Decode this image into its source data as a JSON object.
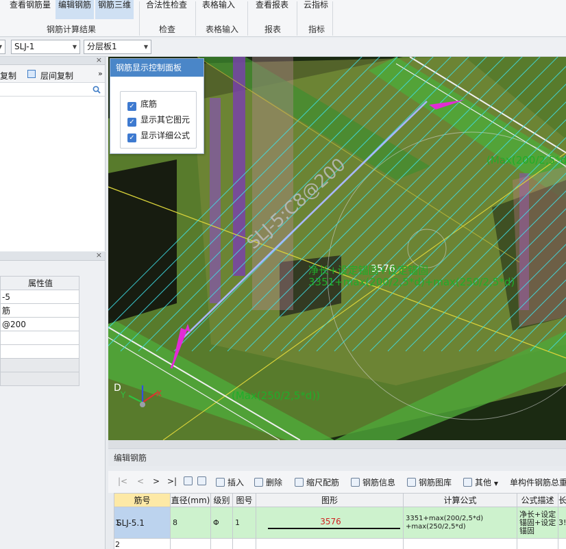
{
  "ribbon": {
    "buttons": {
      "view_rebar_qty": "查看钢筋量",
      "edit_rebar": "编辑钢筋",
      "rebar_3d": "钢筋三维",
      "legality_check": "合法性检查",
      "table_input": "表格输入",
      "view_report": "查看报表",
      "cloud_index": "云指标"
    },
    "groups": {
      "rebar_result": "钢筋计算结果",
      "check": "检查",
      "table_input": "表格输入",
      "report": "报表",
      "index": "指标"
    }
  },
  "selectors": {
    "element": "SLJ-1",
    "layer": "分层板1"
  },
  "left_panel": {
    "copy_label": "复制",
    "floor_copy_label": "层间复制",
    "more_icon": "»",
    "props_header": "属性值",
    "props_values": [
      "-5",
      "筋",
      "@200",
      "",
      "",
      "",
      ""
    ]
  },
  "control_panel": {
    "title": "钢筋显示控制面板",
    "options": [
      {
        "label": "底筋",
        "checked": true
      },
      {
        "label": "显示其它图元",
        "checked": true
      },
      {
        "label": "显示详细公式",
        "checked": true
      }
    ]
  },
  "viewport_labels": {
    "rebar_name": "SLJ-5:C8@200",
    "length": "3576",
    "formula_line1": "净长+设定锚固+设定锚固",
    "formula_line2": "3351+max(200/2,5*d)+max(250/2,5*d)",
    "anchor_right": "(Max(200/2,5*d",
    "anchor_left": "(Max(250/2,5*d))",
    "axis_d": "D",
    "axis_x": "X",
    "axis_y": "Y"
  },
  "editor": {
    "title": "编辑钢筋",
    "nav": [
      "|<",
      "<",
      ">",
      ">|"
    ],
    "toolbar": {
      "insert": "插入",
      "delete": "删除",
      "scale_rebar": "缩尺配筋",
      "rebar_info": "钢筋信息",
      "rebar_library": "钢筋图库",
      "other": "其他",
      "member_total": "单构件钢筋总重"
    },
    "columns": [
      "筋号",
      "直径(mm)",
      "级别",
      "图号",
      "图形",
      "计算公式",
      "公式描述",
      "长"
    ],
    "rows": [
      {
        "num": "1",
        "name": "SLJ-5.1",
        "diameter": "8",
        "grade": "Φ",
        "shape_no": "1",
        "shape_len": "3576",
        "formula1": "3351+max(200/2,5*d)",
        "formula2": "+max(250/2,5*d)",
        "desc1": "净长+设定",
        "desc2": "锚固+设定",
        "desc3": "锚固",
        "len": "3!"
      },
      {
        "num": "2"
      }
    ]
  },
  "colors": {
    "slab_green": "#4fa83a",
    "rebar_cyan": "#3fe0e8",
    "label_green": "#1fae2a",
    "length_white": "#ffffff",
    "arrow_magenta": "#e22bd6",
    "ribbon_active": "#cfe0f3",
    "header_yellow": "#fde9a6",
    "row_green": "#cdf2cd"
  }
}
